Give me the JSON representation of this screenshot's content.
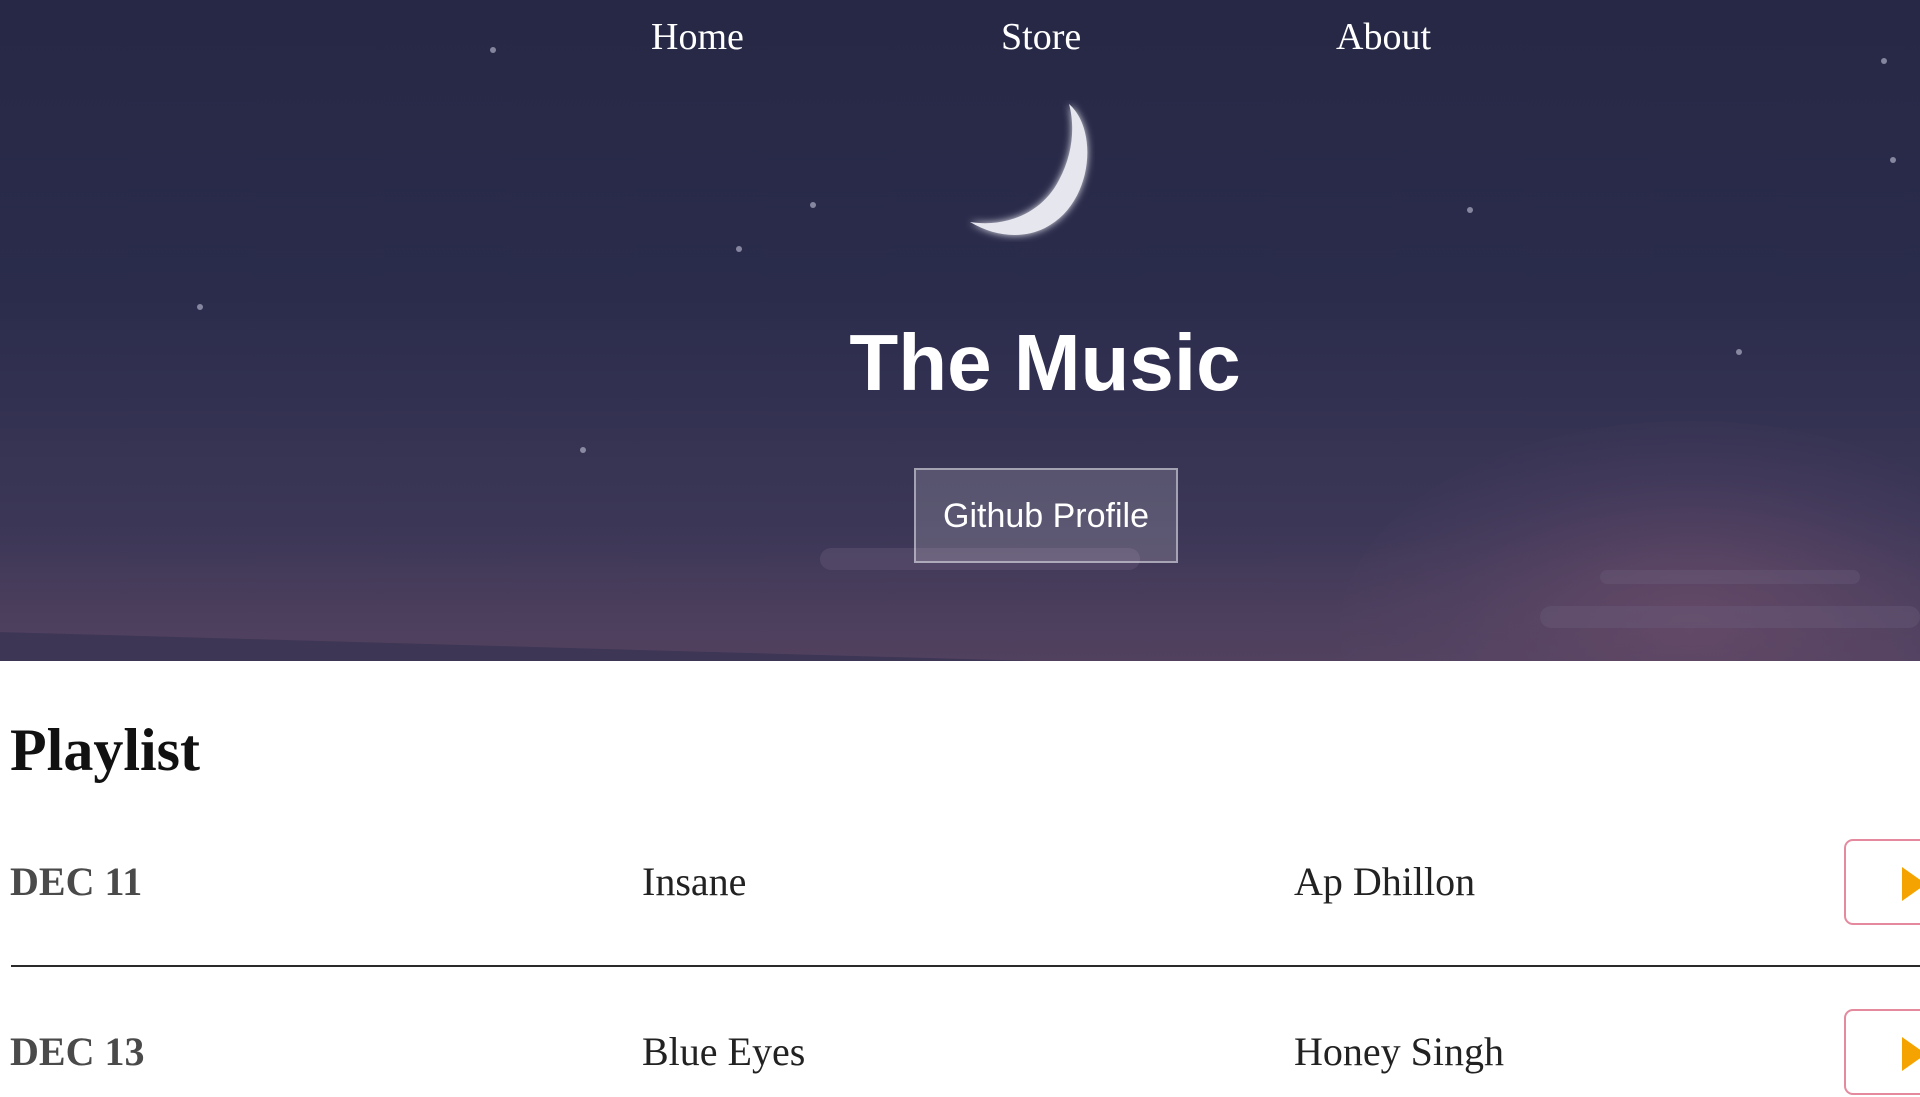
{
  "nav": {
    "items": [
      {
        "label": "Home"
      },
      {
        "label": "Store"
      },
      {
        "label": "About"
      }
    ]
  },
  "hero": {
    "title": "The Music",
    "button_label": "Github Profile",
    "icon": "crescent-moon-icon"
  },
  "playlist": {
    "heading": "Playlist",
    "rows": [
      {
        "date": "DEC 11",
        "song": "Insane",
        "artist": "Ap Dhillon",
        "action_icon": "play-icon"
      },
      {
        "date": "DEC 13",
        "song": "Blue Eyes",
        "artist": "Honey Singh",
        "action_icon": "play-icon"
      }
    ]
  },
  "colors": {
    "hero_top": "#262845",
    "hero_bottom": "#4c3e5c",
    "play_border": "#e58a9e",
    "play_icon": "#f5a300"
  }
}
